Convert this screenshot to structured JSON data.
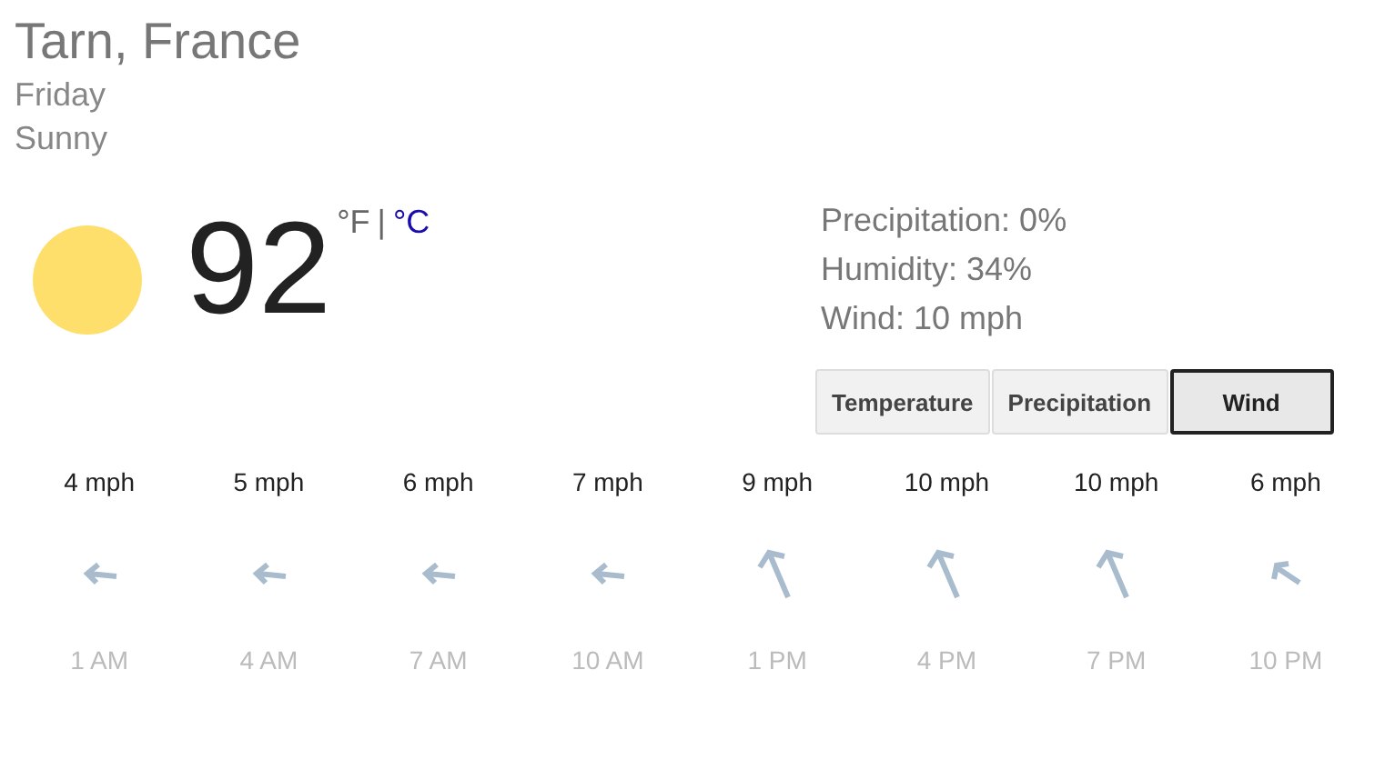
{
  "location": "Tarn, France",
  "day": "Friday",
  "condition": "Sunny",
  "temperature": "92",
  "units": [
    {
      "label": "°F",
      "selected": true
    },
    {
      "label": "°C",
      "selected": false
    }
  ],
  "unit_separator": "|",
  "details": [
    "Precipitation: 0%",
    "Humidity: 34%",
    "Wind: 10 mph"
  ],
  "tabs": [
    {
      "label": "Temperature",
      "selected": false
    },
    {
      "label": "Precipitation",
      "selected": false
    },
    {
      "label": "Wind",
      "selected": true
    }
  ],
  "wind": [
    {
      "speed": "4 mph",
      "kind": "west",
      "time": "1 AM"
    },
    {
      "speed": "5 mph",
      "kind": "west",
      "time": "4 AM"
    },
    {
      "speed": "6 mph",
      "kind": "west",
      "time": "7 AM"
    },
    {
      "speed": "7 mph",
      "kind": "west",
      "time": "10 AM"
    },
    {
      "speed": "9 mph",
      "kind": "northwestbig",
      "time": "1 PM"
    },
    {
      "speed": "10 mph",
      "kind": "northwestbig",
      "time": "4 PM"
    },
    {
      "speed": "10 mph",
      "kind": "northwestbig",
      "time": "7 PM"
    },
    {
      "speed": "6 mph",
      "kind": "northwest",
      "time": "10 PM"
    }
  ]
}
